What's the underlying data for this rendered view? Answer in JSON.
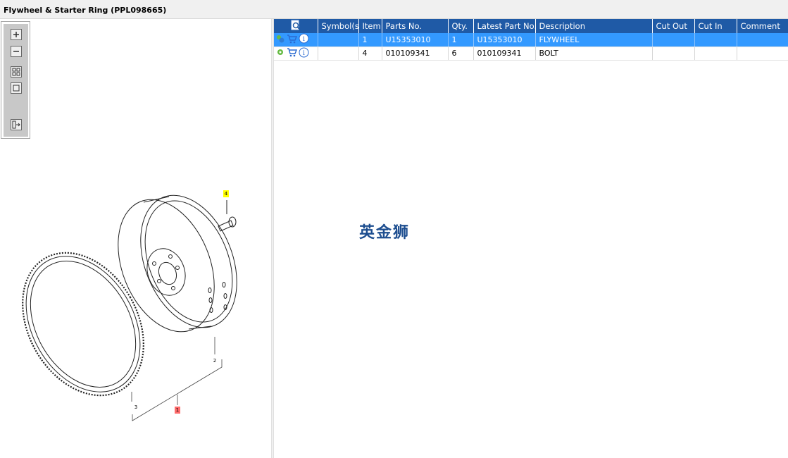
{
  "window": {
    "title": "Flywheel & Starter Ring (PPL098665)"
  },
  "toolbar": {
    "buttons": [
      "zoom-in-icon",
      "zoom-out-icon",
      "fit-all-icon",
      "fit-window-icon",
      "export-icon"
    ]
  },
  "drawing": {
    "callouts": [
      "4",
      "2",
      "3",
      "1"
    ],
    "highlight_colors": {
      "yellow": "#ffff00",
      "red": "#ff6b6b"
    }
  },
  "table": {
    "columns": [
      "Symbol(s)",
      "Item",
      "Parts No.",
      "Qty.",
      "Latest Part No.",
      "Description",
      "Cut Out",
      "Cut In",
      "Comment"
    ],
    "rows": [
      {
        "symbols": "",
        "item": "1",
        "parts_no": "U15353010",
        "qty": "1",
        "latest_part_no": "U15353010",
        "description": "FLYWHEEL",
        "cut_out": "",
        "cut_in": "",
        "comment": "",
        "selected": true
      },
      {
        "symbols": "",
        "item": "4",
        "parts_no": "010109341",
        "qty": "6",
        "latest_part_no": "010109341",
        "description": "BOLT",
        "cut_out": "",
        "cut_in": "",
        "comment": "",
        "selected": false
      }
    ]
  },
  "watermark": "英金狮",
  "colors": {
    "header": "#1f5aa6",
    "selected_row": "#3399ff"
  }
}
